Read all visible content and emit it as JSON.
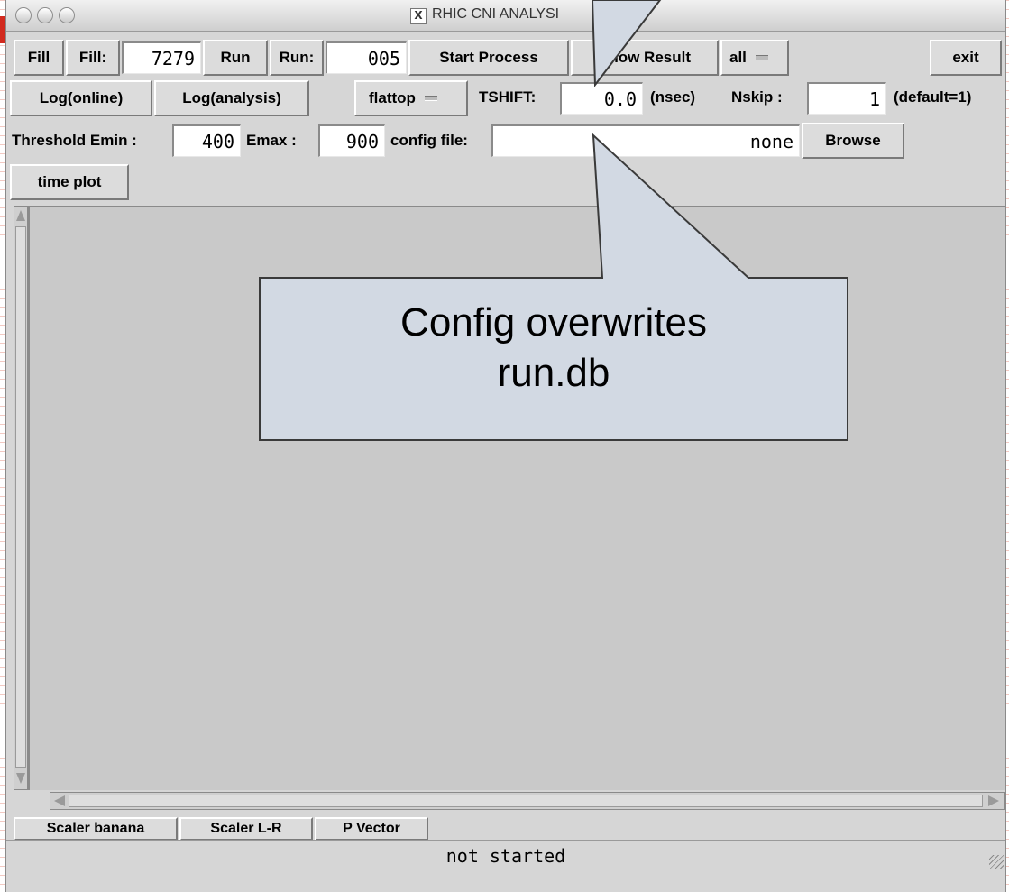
{
  "window": {
    "title": "RHIC CNI ANALYSI"
  },
  "row1": {
    "fill_button": "Fill",
    "fill_label": "Fill:",
    "fill_value": "7279",
    "run_button": "Run",
    "run_label": "Run:",
    "run_value": "005",
    "start_process": "Start Process",
    "show_result": "Show Result",
    "selection_dropdown": "all",
    "exit_button": "exit"
  },
  "row2": {
    "log_online": "Log(online)",
    "log_analysis": "Log(analysis)",
    "mode_dropdown": "flattop",
    "tshift_label": "TSHIFT:",
    "tshift_value": "0.0",
    "nsec_label": "(nsec)",
    "nskip_label": "Nskip :",
    "nskip_value": "1",
    "default_label": "(default=1)"
  },
  "row3": {
    "threshold_label": "Threshold Emin :",
    "emin_value": "400",
    "emax_label": "Emax :",
    "emax_value": "900",
    "config_label": "config file:",
    "config_value": "none",
    "browse_button": "Browse"
  },
  "row4": {
    "time_plot": "time plot"
  },
  "bottom_buttons": [
    "Scaler banana",
    "Scaler L-R",
    "P Vector"
  ],
  "status": "not started",
  "callout": {
    "line1": "Config overwrites",
    "line2": "run.db"
  },
  "icons": {
    "close": "traffic-light-circle",
    "x11": "x11-icon",
    "scroll_up": "arrow-up-icon",
    "scroll_down": "arrow-down-icon",
    "scroll_left": "arrow-left-icon",
    "scroll_right": "arrow-right-icon",
    "resize": "resize-grip-icon"
  },
  "colors": {
    "callout_fill": "#d2d9e3",
    "callout_border": "#3a3a3a",
    "slide_rule_red": "#d22a1e"
  }
}
